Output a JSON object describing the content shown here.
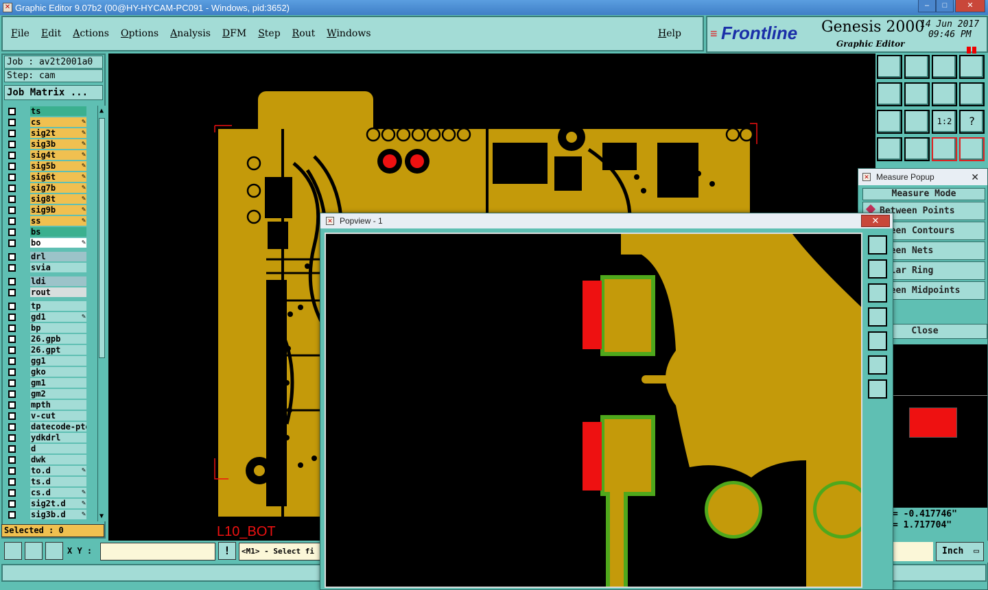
{
  "window": {
    "title": "Graphic Editor 9.07b2 (00@HY-HYCAM-PC091 - Windows, pid:3652)"
  },
  "menu": {
    "items": [
      "File",
      "Edit",
      "Actions",
      "Options",
      "Analysis",
      "DFM",
      "Step",
      "Rout",
      "Windows"
    ],
    "help": "Help"
  },
  "brand": {
    "logo": "Frontline",
    "product": "Genesis 2000",
    "subtitle": "Graphic Editor",
    "date": "14 Jun 2017",
    "time": "09:46 PM"
  },
  "job": {
    "job_label": "Job : av2t2001a0",
    "step_label": "Step: cam",
    "matrix_button": "Job Matrix ..."
  },
  "layers": [
    {
      "name": "ts",
      "color": "#3bb08f",
      "pen": false
    },
    {
      "name": "cs",
      "color": "#f0c050",
      "pen": true
    },
    {
      "name": "sig2t",
      "color": "#f0c050",
      "pen": true
    },
    {
      "name": "sig3b",
      "color": "#f0c050",
      "pen": true
    },
    {
      "name": "sig4t",
      "color": "#f0c050",
      "pen": true
    },
    {
      "name": "sig5b",
      "color": "#f0c050",
      "pen": true
    },
    {
      "name": "sig6t",
      "color": "#f0c050",
      "pen": true
    },
    {
      "name": "sig7b",
      "color": "#f0c050",
      "pen": true
    },
    {
      "name": "sig8t",
      "color": "#f0c050",
      "pen": true
    },
    {
      "name": "sig9b",
      "color": "#f0c050",
      "pen": true
    },
    {
      "name": "ss",
      "color": "#f0c050",
      "pen": true
    },
    {
      "name": "bs",
      "color": "#3bb08f",
      "pen": false
    },
    {
      "name": "bo",
      "color": "#ffffff",
      "pen": true
    },
    {
      "name": "drl",
      "color": "#9cc3c9",
      "pen": false
    },
    {
      "name": "svia",
      "color": "#a3dcd6",
      "pen": false
    },
    {
      "name": "ldi",
      "color": "#9cc3c9",
      "pen": false
    },
    {
      "name": "rout",
      "color": "#d8dede",
      "pen": false
    },
    {
      "name": "tp",
      "color": "#a3dcd6",
      "pen": false
    },
    {
      "name": "gd1",
      "color": "#a3dcd6",
      "pen": true
    },
    {
      "name": "bp",
      "color": "#a3dcd6",
      "pen": false
    },
    {
      "name": "26.gpb",
      "color": "#a3dcd6",
      "pen": false
    },
    {
      "name": "26.gpt",
      "color": "#a3dcd6",
      "pen": false
    },
    {
      "name": "gg1",
      "color": "#a3dcd6",
      "pen": false
    },
    {
      "name": "gko",
      "color": "#a3dcd6",
      "pen": false
    },
    {
      "name": "gm1",
      "color": "#a3dcd6",
      "pen": false
    },
    {
      "name": "gm2",
      "color": "#a3dcd6",
      "pen": false
    },
    {
      "name": "mpth",
      "color": "#a3dcd6",
      "pen": false
    },
    {
      "name": "v-cut",
      "color": "#a3dcd6",
      "pen": false
    },
    {
      "name": "datecode-pto",
      "color": "#a3dcd6",
      "pen": false
    },
    {
      "name": "ydkdrl",
      "color": "#a3dcd6",
      "pen": false
    },
    {
      "name": "d",
      "color": "#a3dcd6",
      "pen": false
    },
    {
      "name": "dwk",
      "color": "#a3dcd6",
      "pen": false
    },
    {
      "name": "to.d",
      "color": "#a3dcd6",
      "pen": true
    },
    {
      "name": "ts.d",
      "color": "#a3dcd6",
      "pen": false
    },
    {
      "name": "cs.d",
      "color": "#a3dcd6",
      "pen": true
    },
    {
      "name": "sig2t.d",
      "color": "#a3dcd6",
      "pen": true
    },
    {
      "name": "sig3b.d",
      "color": "#a3dcd6",
      "pen": true
    }
  ],
  "selected": "Selected : 0",
  "canvas": {
    "layer_label": "L10_BOT"
  },
  "bottom": {
    "xy_label": "X Y :",
    "xy_value": "",
    "prompt": "<M1> - Select fi",
    "unit": "Inch"
  },
  "measure": {
    "title": "Measure Popup",
    "mode_label": "Measure Mode",
    "options": [
      "Between Points",
      "tween Contours",
      "tween Nets",
      "nular Ring",
      "tween Midpoints"
    ],
    "close": "Close",
    "readout_x": "= -0.417746\"",
    "readout_y": "= 1.717704\""
  },
  "popview": {
    "title": "Popview - 1"
  },
  "colors": {
    "copper": "#c49a0a",
    "teal": "#5fbfb3",
    "panel": "#a3dcd6",
    "pad_green": "#4fa81c",
    "pad_red": "#ee1111"
  }
}
